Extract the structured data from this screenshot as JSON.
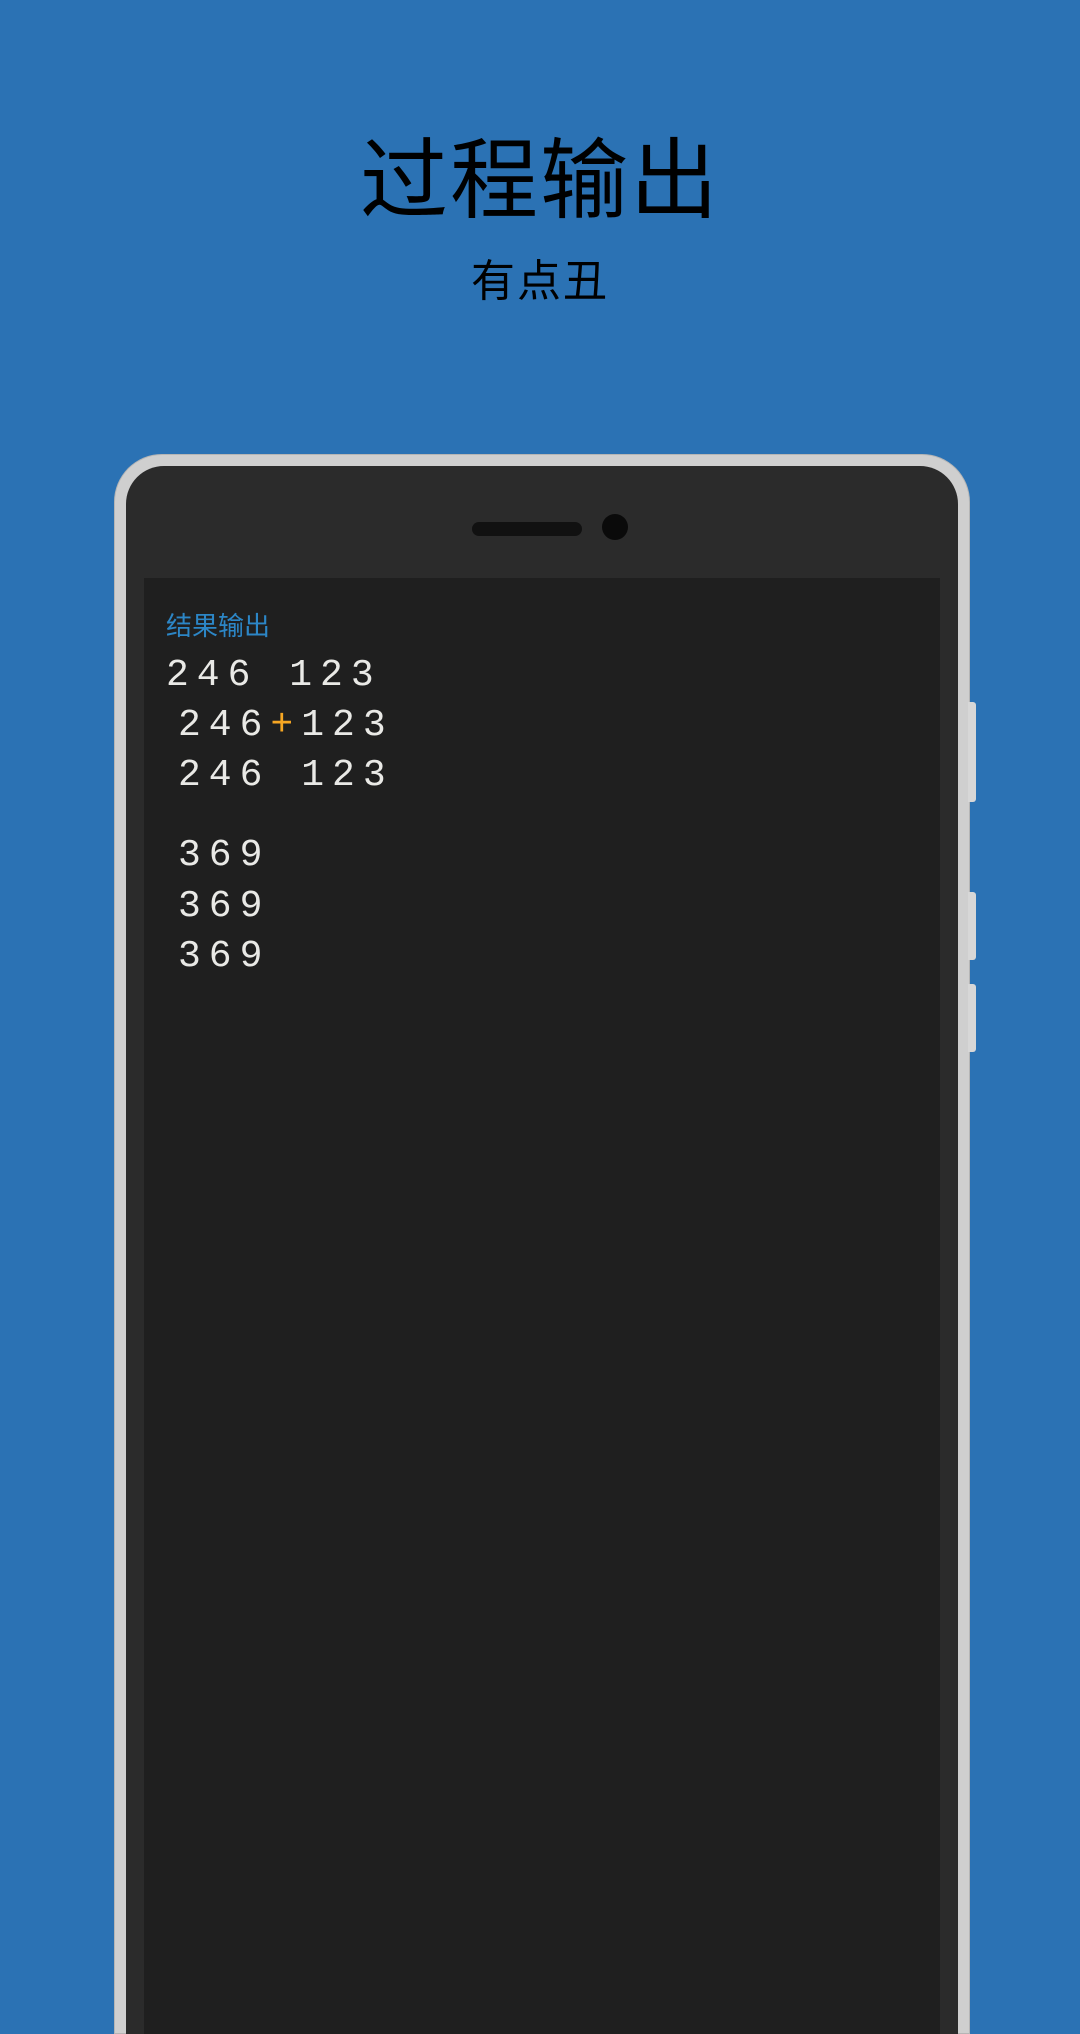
{
  "headline": {
    "title": "过程输出",
    "subtitle": "有点丑"
  },
  "screen": {
    "result_label": "结果输出",
    "block1": {
      "line1": "246 123",
      "line2_left": "246",
      "line2_op": "+",
      "line2_right": "123",
      "line3": "246 123"
    },
    "block2": {
      "line1": "369",
      "line2": "369",
      "line3": "369"
    }
  }
}
